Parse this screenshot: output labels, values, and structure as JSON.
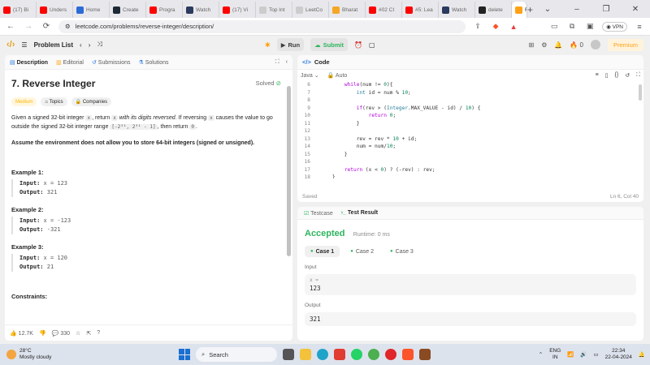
{
  "browser": {
    "tabs": [
      {
        "label": "(17) Bi",
        "color": "#ff0000"
      },
      {
        "label": "Unders",
        "color": "#ff0000"
      },
      {
        "label": "Home",
        "color": "#2c6bd6"
      },
      {
        "label": "Create",
        "color": "#1d2a35"
      },
      {
        "label": "Progra",
        "color": "#ff0000"
      },
      {
        "label": "Watch",
        "color": "#2b3a5e"
      },
      {
        "label": "(17) Vi",
        "color": "#ff0000"
      },
      {
        "label": "Top Int",
        "color": "#ccc"
      },
      {
        "label": "LeetCo",
        "color": "#ccc"
      },
      {
        "label": "Bharat",
        "color": "#f5a623"
      },
      {
        "label": "#02 CI",
        "color": "#ff0000"
      },
      {
        "label": "#5: Lea",
        "color": "#ff0000"
      },
      {
        "label": "Watch",
        "color": "#2b3a5e"
      },
      {
        "label": "delete",
        "color": "#222"
      }
    ],
    "active_tab": "Re",
    "url": "leetcode.com/problems/reverse-integer/description/",
    "vpn_label": "VPN"
  },
  "lc_nav": {
    "problem_list": "Problem List",
    "run": "Run",
    "submit": "Submit",
    "streak": "0",
    "premium": "Premium"
  },
  "left_tabs": {
    "description": "Description",
    "editorial": "Editorial",
    "submissions": "Submissions",
    "solutions": "Solutions"
  },
  "problem": {
    "title": "7. Reverse Integer",
    "solved": "Solved",
    "difficulty": "Medium",
    "topics": "Topics",
    "companies": "Companies",
    "p1_a": "Given a signed 32-bit integer ",
    "p1_x": "x",
    "p1_b": ", return ",
    "p1_c": "x",
    "p1_d": " with its digits reversed",
    "p1_e": ". If reversing ",
    "p1_f": "x",
    "p1_g": " causes the value to go outside the signed 32-bit integer range ",
    "p1_range": "[-2³¹, 2³¹ - 1]",
    "p1_h": ", then return ",
    "p1_zero": "0",
    "p1_end": ".",
    "assume": "Assume the environment does not allow you to store 64-bit integers (signed or unsigned).",
    "examples": [
      {
        "head": "Example 1:",
        "input_label": "Input:",
        "input": "x = 123",
        "output_label": "Output:",
        "output": "321"
      },
      {
        "head": "Example 2:",
        "input_label": "Input:",
        "input": "x = -123",
        "output_label": "Output:",
        "output": "-321"
      },
      {
        "head": "Example 3:",
        "input_label": "Input:",
        "input": "x = 120",
        "output_label": "Output:",
        "output": "21"
      }
    ],
    "constraints": "Constraints:",
    "likes": "12.7K",
    "comments": "330"
  },
  "code_panel": {
    "title": "Code",
    "language": "Java",
    "mode": "Auto",
    "saved": "Saved",
    "cursor": "Ln 6, Col 40",
    "lines": [
      {
        "n": "6",
        "t": "        while(num != 0){"
      },
      {
        "n": "7",
        "t": "            int id = num % 10;"
      },
      {
        "n": "8",
        "t": ""
      },
      {
        "n": "9",
        "t": "            if(rev > (Integer.MAX_VALUE - id) / 10) {"
      },
      {
        "n": "10",
        "t": "                return 0;"
      },
      {
        "n": "11",
        "t": "            }"
      },
      {
        "n": "12",
        "t": ""
      },
      {
        "n": "13",
        "t": "            rev = rev * 10 + id;"
      },
      {
        "n": "14",
        "t": "            num = num/10;"
      },
      {
        "n": "15",
        "t": "        }"
      },
      {
        "n": "16",
        "t": ""
      },
      {
        "n": "17",
        "t": "        return (x < 0) ? (-rev) : rev;"
      },
      {
        "n": "18",
        "t": "    }"
      }
    ]
  },
  "test_panel": {
    "testcase_tab": "Testcase",
    "result_tab": "Test Result",
    "status": "Accepted",
    "runtime": "Runtime: 0 ms",
    "cases": [
      "Case 1",
      "Case 2",
      "Case 3"
    ],
    "input_label": "Input",
    "input_var": "x =",
    "input_value": "123",
    "output_label": "Output",
    "output_value": "321"
  },
  "taskbar": {
    "temp": "28°C",
    "weather": "Mostly cloudy",
    "search": "Search",
    "lang1": "ENG",
    "lang2": "IN",
    "time": "22:34",
    "date": "22-04-2024"
  }
}
